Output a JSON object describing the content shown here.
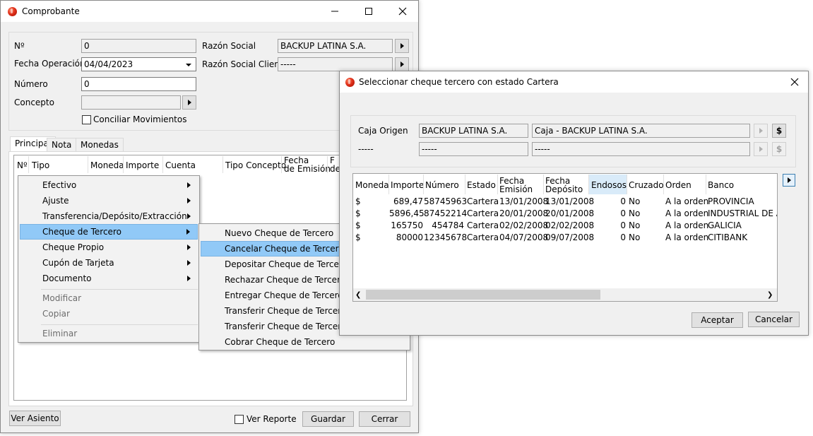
{
  "main_window": {
    "title": "Comprobante",
    "labels": {
      "numero_sign": "Nº",
      "fecha_operacion": "Fecha Operación",
      "numero": "Número",
      "concepto": "Concepto",
      "razon_social": "Razón Social",
      "razon_social_cliente": "Razón Social Cliente"
    },
    "fields": {
      "numero_sign": "0",
      "fecha_operacion": "04/04/2023",
      "numero": "0",
      "concepto": "",
      "razon_social": "BACKUP LATINA S.A.",
      "razon_social_cliente": "-----"
    },
    "conciliar_label": "Conciliar Movimientos",
    "tabs": [
      "Principal",
      "Nota",
      "Monedas"
    ],
    "columns": [
      "Nº",
      "Tipo",
      "Moneda",
      "Importe",
      "Cuenta",
      "Tipo Concepto",
      "Fecha\nde Emisión",
      "F\nde"
    ],
    "ver_asiento": "Ver Asiento",
    "ver_reporte": "Ver Reporte",
    "guardar": "Guardar",
    "cerrar": "Cerrar"
  },
  "context_menu": {
    "items": [
      "Efectivo",
      "Ajuste",
      "Transferencia/Depósito/Extracción",
      "Cheque de Tercero",
      "Cheque Propio",
      "Cupón de Tarjeta",
      "Documento"
    ],
    "disabled_items": [
      "Modificar",
      "Copiar",
      "Eliminar"
    ]
  },
  "submenu": {
    "items": [
      "Nuevo Cheque de Tercero",
      "Cancelar Cheque de Tercero",
      "Depositar Cheque de Tercero",
      "Rechazar Cheque de Tercero",
      "Entregar Cheque de Tercero",
      "Transferir Cheque de Tercero er",
      "Transferir Cheque de Tercero er",
      "Cobrar Cheque de Tercero"
    ]
  },
  "dialog": {
    "title": "Seleccionar cheque tercero con estado Cartera",
    "caja_origen_label": "Caja Origen",
    "caja_origen_empresa": "BACKUP LATINA S.A.",
    "caja_origen_caja": "Caja - BACKUP LATINA S.A.",
    "row2_label": "-----",
    "row2_a": "-----",
    "row2_b": "-----",
    "dollar": "$",
    "columns": [
      "Moneda",
      "Importe",
      "Número",
      "Estado",
      "Fecha\nEmisión",
      "Fecha\nDepósito",
      "Endosos",
      "Cruzado",
      "Orden",
      "Banco"
    ],
    "rows": [
      [
        "$",
        "689,47",
        "58745963",
        "Cartera",
        "13/01/2008",
        "13/01/2008",
        "0",
        "No",
        "A la orden",
        "PROVINCIA"
      ],
      [
        "$",
        "5896,45",
        "87452214",
        "Cartera",
        "20/01/2008",
        "20/01/2008",
        "0",
        "No",
        "A la orden",
        "INDUSTRIAL DE AZ"
      ],
      [
        "$",
        "165750",
        "454784",
        "Cartera",
        "02/02/2008",
        "02/02/2008",
        "0",
        "No",
        "A la orden",
        "GALICIA"
      ],
      [
        "$",
        "80000",
        "12345678",
        "Cartera",
        "04/07/2008",
        "09/07/2008",
        "0",
        "No",
        "A la orden",
        "CITIBANK"
      ]
    ],
    "aceptar": "Aceptar",
    "cancelar": "Cancelar"
  },
  "colors": {
    "highlight": "#91c9f7",
    "sorted_header": "#d9ebf9",
    "window_bg": "#f0f0f0"
  }
}
